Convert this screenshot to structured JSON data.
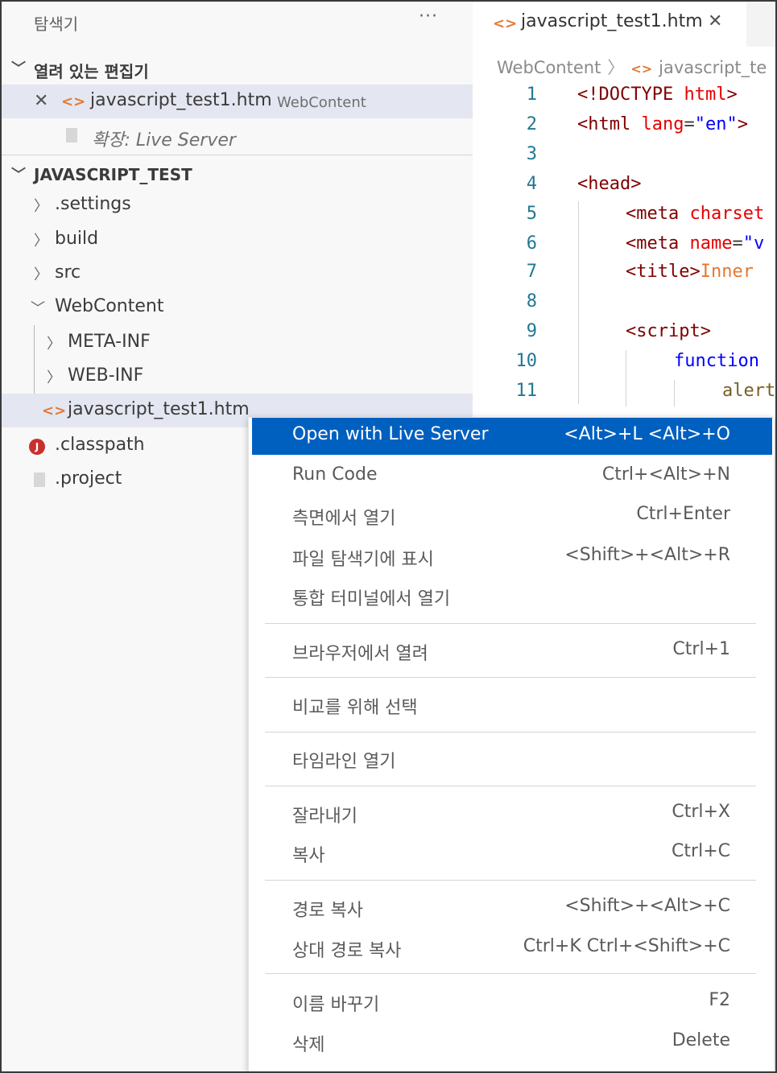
{
  "explorer": {
    "title": "탐색기",
    "more": "···",
    "open_editors": {
      "header": "열려 있는 편집기",
      "file_name": "javascript_test1.htm",
      "file_path": "WebContent",
      "extension_item": "확장: Live Server"
    },
    "project": {
      "header": "JAVASCRIPT_TEST",
      "items": [
        {
          "label": ".settings"
        },
        {
          "label": "build"
        },
        {
          "label": "src"
        },
        {
          "label": "WebContent"
        },
        {
          "label": "META-INF"
        },
        {
          "label": "WEB-INF"
        },
        {
          "label": "javascript_test1.htm"
        },
        {
          "label": ".classpath"
        },
        {
          "label": ".project"
        }
      ],
      "classpath_icon": "J"
    }
  },
  "editor": {
    "tab_label": "javascript_test1.htm",
    "breadcrumb": [
      "WebContent",
      "javascript_te"
    ],
    "lines": [
      {
        "n": "1"
      },
      {
        "n": "2"
      },
      {
        "n": "3"
      },
      {
        "n": "4"
      },
      {
        "n": "5"
      },
      {
        "n": "6"
      },
      {
        "n": "7"
      },
      {
        "n": "8"
      },
      {
        "n": "9"
      },
      {
        "n": "10"
      },
      {
        "n": "11"
      }
    ],
    "code": {
      "l1_open": "<!DOCTYPE",
      "l1_kw": "html",
      "l1_close": ">",
      "l2_tag": "<html",
      "l2_attr": "lang",
      "l2_eq": "=",
      "l2_val": "\"en\"",
      "l2_close": ">",
      "l4": "<head>",
      "l5_tag": "<meta",
      "l5_attr": "charset",
      "l6_tag": "<meta",
      "l6_attr": "name",
      "l6_eq": "=",
      "l6_val": "\"v",
      "l7_tag": "<title>",
      "l7_text": "Inner",
      "l9": "<script>",
      "l10": "function",
      "l11": "alert"
    }
  },
  "context_menu": {
    "items": [
      {
        "label": "Open with Live Server",
        "shortcut": "<Alt>+L <Alt>+O"
      },
      {
        "label": "Run Code",
        "shortcut": "Ctrl+<Alt>+N"
      },
      {
        "label": "측면에서 열기",
        "shortcut": "Ctrl+Enter"
      },
      {
        "label": "파일 탐색기에 표시",
        "shortcut": "<Shift>+<Alt>+R"
      },
      {
        "label": "통합 터미널에서 열기",
        "shortcut": ""
      },
      {
        "label": "브라우저에서 열려",
        "shortcut": "Ctrl+1"
      },
      {
        "label": "비교를 위해 선택",
        "shortcut": ""
      },
      {
        "label": "타임라인 열기",
        "shortcut": ""
      },
      {
        "label": "잘라내기",
        "shortcut": "Ctrl+X"
      },
      {
        "label": "복사",
        "shortcut": "Ctrl+C"
      },
      {
        "label": "경로 복사",
        "shortcut": "<Shift>+<Alt>+C"
      },
      {
        "label": "상대 경로 복사",
        "shortcut": "Ctrl+K Ctrl+<Shift>+C"
      },
      {
        "label": "이름 바꾸기",
        "shortcut": "F2"
      },
      {
        "label": "삭제",
        "shortcut": "Delete"
      }
    ]
  },
  "colors": {
    "menu_highlight": "#0060c0",
    "selection": "#e4e6f1",
    "html_icon": "#e37933",
    "line_number": "#237893"
  }
}
